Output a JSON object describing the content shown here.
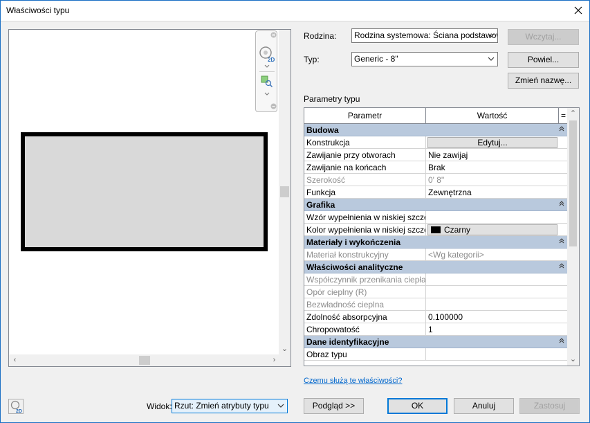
{
  "window": {
    "title": "Właściwości typu"
  },
  "form": {
    "family_label": "Rodzina:",
    "family_value": "Rodzina systemowa: Ściana podstawowa",
    "type_label": "Typ:",
    "type_value": "Generic - 8\"",
    "load_button": "Wczytaj...",
    "duplicate_button": "Powiel...",
    "rename_button": "Zmień nazwę...",
    "params_label": "Parametry typu"
  },
  "table": {
    "headers": [
      "Parametr",
      "Wartość",
      "="
    ],
    "groups": [
      {
        "label": "Budowa",
        "rows": [
          {
            "param": "Konstrukcja",
            "value": "Edytuj...",
            "kind": "button"
          },
          {
            "param": "Zawijanie przy otworach",
            "value": "Nie zawijaj"
          },
          {
            "param": "Zawijanie na końcach",
            "value": "Brak"
          },
          {
            "param": "Szerokość",
            "value": "0'  8\"",
            "disabled": true
          },
          {
            "param": "Funkcja",
            "value": "Zewnętrzna"
          }
        ]
      },
      {
        "label": "Grafika",
        "rows": [
          {
            "param": "Wzór wypełnienia w niskiej szcze",
            "value": ""
          },
          {
            "param": "Kolor wypełnienia w niskiej szcze",
            "value": "Czarny",
            "kind": "color"
          }
        ]
      },
      {
        "label": "Materiały i wykończenia",
        "rows": [
          {
            "param": "Materiał konstrukcyjny",
            "value": "<Wg kategorii>",
            "disabled": true
          }
        ]
      },
      {
        "label": "Właściwości analityczne",
        "rows": [
          {
            "param": "Współczynnik przenikania ciepła",
            "value": "",
            "disabled": true
          },
          {
            "param": "Opór cieplny (R)",
            "value": "",
            "disabled": true
          },
          {
            "param": "Bezwładność cieplna",
            "value": "",
            "disabled": true
          },
          {
            "param": "Zdolność absorpcyjna",
            "value": "0.100000"
          },
          {
            "param": "Chropowatość",
            "value": "1"
          }
        ]
      },
      {
        "label": "Dane identyfikacyjne",
        "rows": [
          {
            "param": "Obraz typu",
            "value": ""
          }
        ]
      }
    ]
  },
  "help_link": "Czemu służą te właściwości?",
  "footer": {
    "view_label": "Widok:",
    "view_value": "Rzut: Zmień atrybuty typu",
    "preview_button": "Podgląd >>",
    "ok_button": "OK",
    "cancel_button": "Anuluj",
    "apply_button": "Zastosuj"
  },
  "colors": {
    "accent": "#0078d7",
    "group_header": "#b9c9dd",
    "link": "#0066cc",
    "swatch_black": "#000000"
  },
  "icons": [
    "close-icon",
    "steering-wheel-2d-icon",
    "zoom-region-icon",
    "chevron-down-icon",
    "collapse-icon"
  ]
}
